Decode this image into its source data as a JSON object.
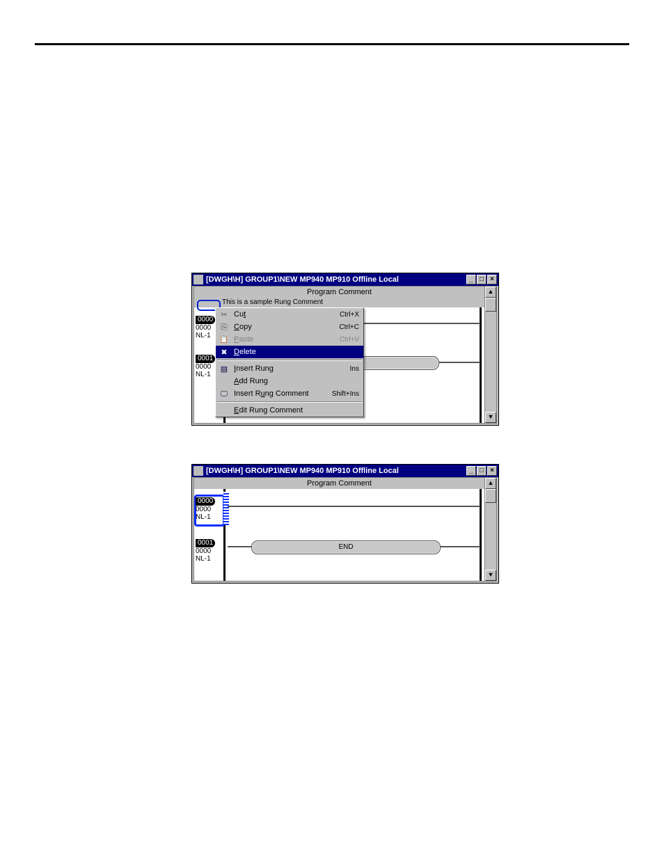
{
  "window1": {
    "title": "[DWGH\\H]   GROUP1\\NEW  MP940  MP910    Offline  Local",
    "program_comment_label": "Program Comment",
    "rung_comment_text": "This is a sample Rung Comment",
    "rungs": [
      {
        "badge": "0000",
        "line2": "0000",
        "line3": "NL-1"
      },
      {
        "badge": "0001",
        "line2": "0000",
        "line3": "NL-1"
      }
    ],
    "context_menu": {
      "items": [
        {
          "key": "cut",
          "label_html": "Cu<u>t</u>",
          "shortcut": "Ctrl+X",
          "icon": "scissors",
          "disabled": false
        },
        {
          "key": "copy",
          "label_html": "<u>C</u>opy",
          "shortcut": "Ctrl+C",
          "icon": "copy",
          "disabled": false
        },
        {
          "key": "paste",
          "label_html": "<u>P</u>aste",
          "shortcut": "Ctrl+V",
          "icon": "paste",
          "disabled": true
        },
        {
          "key": "delete",
          "label_html": "<u>D</u>elete",
          "shortcut": "",
          "icon": "x",
          "disabled": false,
          "highlight": true
        },
        {
          "sep": true
        },
        {
          "key": "insertrung",
          "label_html": "<u>I</u>nsert Rung",
          "shortcut": "Ins",
          "icon": "rung",
          "disabled": false
        },
        {
          "key": "addrung",
          "label_html": "<u>A</u>dd Rung",
          "shortcut": "",
          "icon": "",
          "disabled": false
        },
        {
          "key": "insertcomm",
          "label_html": "Insert R<u>u</u>ng Comment",
          "shortcut": "Shift+Ins",
          "icon": "comment",
          "disabled": false
        },
        {
          "sep": true
        },
        {
          "key": "editcomm",
          "label_html": "<u>E</u>dit Rung Comment",
          "shortcut": "",
          "icon": "",
          "disabled": false
        }
      ]
    }
  },
  "window2": {
    "title": "[DWGH\\H]   GROUP1\\NEW  MP940  MP910    Offline  Local",
    "program_comment_label": "Program Comment",
    "rungs": [
      {
        "badge": "0000",
        "line2": "0000",
        "line3": "NL-1",
        "selected": true
      },
      {
        "badge": "0001",
        "line2": "0000",
        "line3": "NL-1"
      }
    ],
    "end_label": "END"
  },
  "win_buttons": {
    "min": "_",
    "max": "□",
    "close": "×"
  }
}
